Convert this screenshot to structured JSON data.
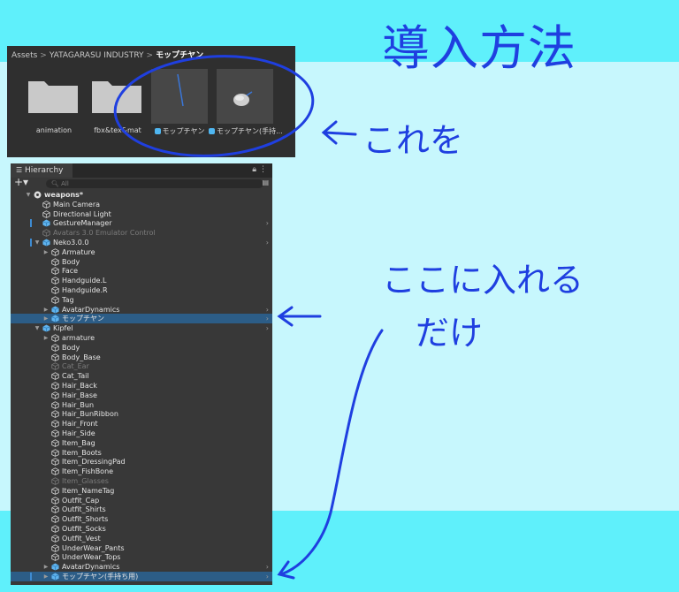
{
  "annotations": {
    "title": "導入方法",
    "this_one": "これを",
    "put_here": "ここに入れる",
    "just": "だけ",
    "ink_color": "#1f3fe0"
  },
  "assets": {
    "breadcrumb": [
      "Assets",
      "YATAGARASU INDUSTRY",
      "モップチヤン"
    ],
    "items": [
      {
        "label": "animation",
        "kind": "folder"
      },
      {
        "label": "fbx&tex&mat",
        "kind": "folder"
      },
      {
        "label": "モップチヤン",
        "kind": "prefab"
      },
      {
        "label": "モップチヤン(手持...",
        "kind": "prefab"
      }
    ]
  },
  "hierarchy": {
    "tab": "Hierarchy",
    "search_placeholder": "All",
    "rows": [
      {
        "text": "weapons*",
        "icon": "scene-icon",
        "depth": 0,
        "fold": "open",
        "bold": true
      },
      {
        "text": "Main Camera",
        "icon": "gameobject-icon",
        "depth": 1
      },
      {
        "text": "Directional Light",
        "icon": "gameobject-icon",
        "depth": 1
      },
      {
        "text": "GestureManager",
        "icon": "prefab-icon",
        "depth": 1,
        "chevron": true,
        "bar": true
      },
      {
        "text": "Avatars 3.0 Emulator Control",
        "icon": "gameobject-icon",
        "depth": 1,
        "dim": true
      },
      {
        "text": "Neko3.0.0",
        "icon": "prefab-icon",
        "depth": 1,
        "fold": "open",
        "chevron": true,
        "bar": true
      },
      {
        "text": "Armature",
        "icon": "gameobject-icon",
        "depth": 2,
        "fold": "closed"
      },
      {
        "text": "Body",
        "icon": "gameobject-icon",
        "depth": 2
      },
      {
        "text": "Face",
        "icon": "gameobject-icon",
        "depth": 2
      },
      {
        "text": "Handguide.L",
        "icon": "gameobject-icon",
        "depth": 2
      },
      {
        "text": "Handguide.R",
        "icon": "gameobject-icon",
        "depth": 2
      },
      {
        "text": "Tag",
        "icon": "gameobject-icon",
        "depth": 2
      },
      {
        "text": "AvatarDynamics",
        "icon": "prefab-icon",
        "depth": 2,
        "fold": "closed",
        "chevron": true
      },
      {
        "text": "モップチヤン",
        "icon": "prefab-icon",
        "depth": 2,
        "fold": "closed",
        "chevron": true,
        "selected": true
      },
      {
        "text": "Kipfel",
        "icon": "prefab-icon",
        "depth": 1,
        "fold": "open",
        "chevron": true
      },
      {
        "text": "armature",
        "icon": "gameobject-icon",
        "depth": 2,
        "fold": "closed"
      },
      {
        "text": "Body",
        "icon": "gameobject-icon",
        "depth": 2
      },
      {
        "text": "Body_Base",
        "icon": "gameobject-icon",
        "depth": 2
      },
      {
        "text": "Cat_Ear",
        "icon": "gameobject-icon",
        "depth": 2,
        "dim": true
      },
      {
        "text": "Cat_Tail",
        "icon": "gameobject-icon",
        "depth": 2
      },
      {
        "text": "Hair_Back",
        "icon": "gameobject-icon",
        "depth": 2
      },
      {
        "text": "Hair_Base",
        "icon": "gameobject-icon",
        "depth": 2
      },
      {
        "text": "Hair_Bun",
        "icon": "gameobject-icon",
        "depth": 2
      },
      {
        "text": "Hair_BunRibbon",
        "icon": "gameobject-icon",
        "depth": 2
      },
      {
        "text": "Hair_Front",
        "icon": "gameobject-icon",
        "depth": 2
      },
      {
        "text": "Hair_Side",
        "icon": "gameobject-icon",
        "depth": 2
      },
      {
        "text": "Item_Bag",
        "icon": "gameobject-icon",
        "depth": 2
      },
      {
        "text": "Item_Boots",
        "icon": "gameobject-icon",
        "depth": 2
      },
      {
        "text": "Item_DressingPad",
        "icon": "gameobject-icon",
        "depth": 2
      },
      {
        "text": "Item_FishBone",
        "icon": "gameobject-icon",
        "depth": 2
      },
      {
        "text": "Item_Glasses",
        "icon": "gameobject-icon",
        "depth": 2,
        "dim": true
      },
      {
        "text": "Item_NameTag",
        "icon": "gameobject-icon",
        "depth": 2
      },
      {
        "text": "Outfit_Cap",
        "icon": "gameobject-icon",
        "depth": 2
      },
      {
        "text": "Outfit_Shirts",
        "icon": "gameobject-icon",
        "depth": 2
      },
      {
        "text": "Outfit_Shorts",
        "icon": "gameobject-icon",
        "depth": 2
      },
      {
        "text": "Outfit_Socks",
        "icon": "gameobject-icon",
        "depth": 2
      },
      {
        "text": "Outfit_Vest",
        "icon": "gameobject-icon",
        "depth": 2
      },
      {
        "text": "UnderWear_Pants",
        "icon": "gameobject-icon",
        "depth": 2
      },
      {
        "text": "UnderWear_Tops",
        "icon": "gameobject-icon",
        "depth": 2
      },
      {
        "text": "AvatarDynamics",
        "icon": "prefab-icon",
        "depth": 2,
        "fold": "closed",
        "chevron": true
      },
      {
        "text": "モップチヤン(手持ち用)",
        "icon": "prefab-icon",
        "depth": 2,
        "fold": "closed",
        "chevron": true,
        "selected": true,
        "bar": true
      }
    ]
  }
}
